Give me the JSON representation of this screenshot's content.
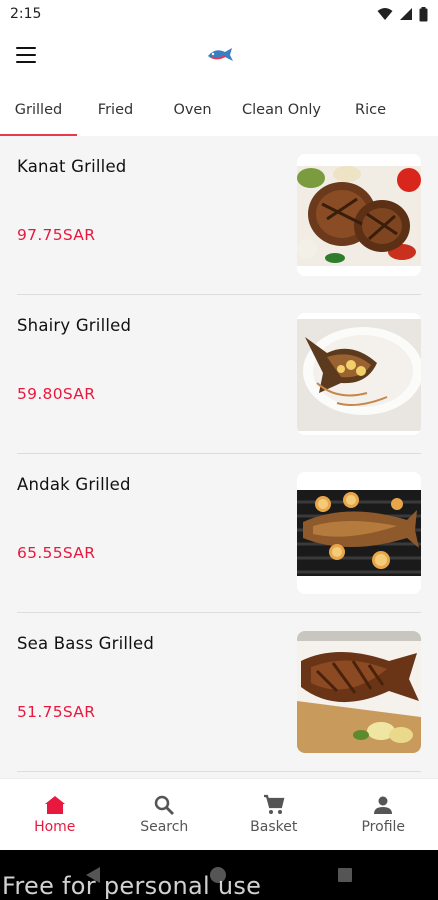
{
  "status_bar": {
    "time": "2:15"
  },
  "tabs": [
    {
      "label": "Grilled",
      "active": true
    },
    {
      "label": "Fried"
    },
    {
      "label": "Oven"
    },
    {
      "label": "Clean Only"
    },
    {
      "label": "Rice"
    }
  ],
  "products": [
    {
      "name": "Kanat Grilled",
      "price": "97.75SAR",
      "image": "grilled-fish-steaks-image"
    },
    {
      "name": "Shairy Grilled",
      "price": "59.80SAR",
      "image": "whole-grilled-fish-plate-image"
    },
    {
      "name": "Andak Grilled",
      "price": "65.55SAR",
      "image": "fish-on-grill-image"
    },
    {
      "name": "Sea Bass Grilled",
      "price": "51.75SAR",
      "image": "sea-bass-board-image"
    }
  ],
  "bottom_nav": [
    {
      "label": "Home",
      "icon": "home-icon",
      "active": true
    },
    {
      "label": "Search",
      "icon": "search-icon"
    },
    {
      "label": "Basket",
      "icon": "cart-icon"
    },
    {
      "label": "Profile",
      "icon": "person-icon"
    }
  ],
  "watermark": "Free for personal use",
  "colors": {
    "accent": "#e8193f",
    "background": "#f6f5f5"
  }
}
